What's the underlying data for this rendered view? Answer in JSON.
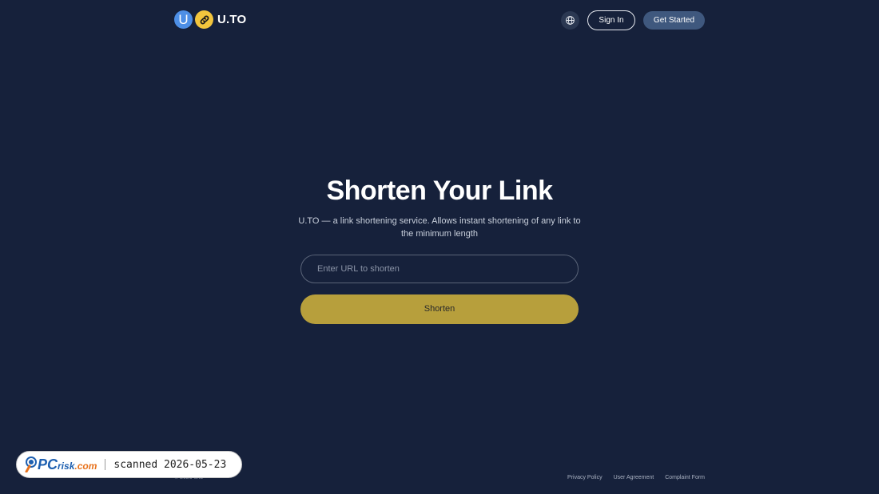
{
  "header": {
    "logo_letter": "U",
    "logo_text": "U.TO",
    "sign_in_label": "Sign In",
    "get_started_label": "Get Started"
  },
  "hero": {
    "title": "Shorten Your Link",
    "subtitle": "U.TO — a link shortening service. Allows instant shortening of any link to the minimum length",
    "input_placeholder": "Enter URL to shorten",
    "input_value": "",
    "shorten_label": "Shorten"
  },
  "footer": {
    "copyright": "© 2026 u.to",
    "links": [
      "Privacy Policy",
      "User Agreement",
      "Complaint Form"
    ]
  },
  "watermark": {
    "brand_prefix": "PC",
    "brand_suffix": "risk",
    "brand_domain": ".com",
    "scan_text": "scanned 2026-05-23"
  },
  "colors": {
    "background": "#16213b",
    "accent_yellow": "#b79f3c",
    "logo_blue": "#4d8fe6",
    "logo_yellow": "#f2c53d",
    "primary_button": "#3f587e"
  },
  "icons": {
    "logo_link": "link-icon",
    "language": "globe-icon"
  }
}
